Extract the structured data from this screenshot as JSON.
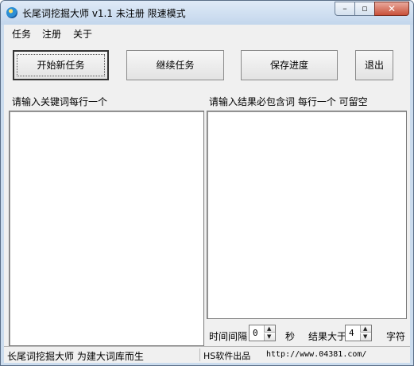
{
  "window": {
    "title": "长尾词挖掘大师 v1.1  未注册  限速模式",
    "minimize_glyph": "–",
    "maximize_glyph": "▫",
    "close_glyph": "✕"
  },
  "menu": {
    "items": [
      {
        "label": "任务"
      },
      {
        "label": "注册"
      },
      {
        "label": "关于"
      }
    ]
  },
  "toolbar": {
    "start_label": "开始新任务",
    "continue_label": "继续任务",
    "save_label": "保存进度",
    "exit_label": "退出"
  },
  "left_panel": {
    "label": "请输入关键词每行一个",
    "value": ""
  },
  "right_panel": {
    "label": "请输入结果必包含词  每行一个 可留空",
    "value": ""
  },
  "settings": {
    "interval_label": "时间间隔",
    "interval_value": "0",
    "interval_unit": "秒",
    "length_label": "结果大于",
    "length_value": "4",
    "length_unit": "字符"
  },
  "statusbar": {
    "left": "长尾词挖掘大师  为建大词库而生",
    "middle": "HS软件出品",
    "url": "http://www.04381.com/"
  },
  "icons": {
    "app": "app-globe-icon",
    "spin_up": "chevron-up-icon",
    "spin_down": "chevron-down-icon"
  }
}
